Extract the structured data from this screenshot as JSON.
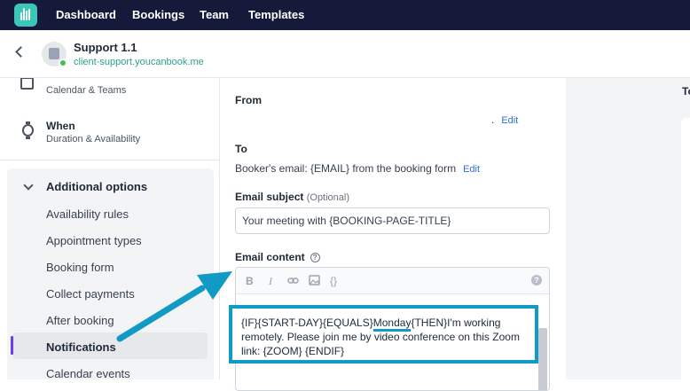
{
  "nav": {
    "items": [
      "Dashboard",
      "Bookings",
      "Team",
      "Templates"
    ]
  },
  "header": {
    "title": "Support 1.1",
    "url": "client-support.youcanbook.me"
  },
  "sidebar": {
    "calendar_sub": "Calendar & Teams",
    "when_title": "When",
    "when_sub": "Duration & Availability",
    "group_title": "Additional options",
    "items": [
      {
        "label": "Availability rules",
        "active": false
      },
      {
        "label": "Appointment types",
        "active": false
      },
      {
        "label": "Booking form",
        "active": false
      },
      {
        "label": "Collect payments",
        "active": false
      },
      {
        "label": "After booking",
        "active": false
      },
      {
        "label": "Notifications",
        "active": true
      },
      {
        "label": "Calendar events",
        "active": false
      }
    ]
  },
  "main": {
    "from_label": "From",
    "from_value": ".",
    "from_edit": "Edit",
    "to_label": "To",
    "to_value": "Booker's email: {EMAIL} from the booking form",
    "to_edit": "Edit",
    "subject_label": "Email subject",
    "subject_optional": "(Optional)",
    "subject_value": "Your meeting with {BOOKING-PAGE-TITLE}",
    "content_label": "Email content",
    "content_help": "?",
    "toolbar": {
      "bold": "B",
      "italic": "I",
      "code": "{}",
      "help": "?"
    },
    "highlight": {
      "part1": "{IF}{START-DAY}{EQUALS}",
      "part2": "Monday",
      "part3": "{THEN}I'm working remotely. Please join me by video conference on this Zoom link: {ZOOM} {ENDIF}"
    }
  },
  "right_panel": {
    "text": "To"
  },
  "colors": {
    "nav_bg": "#161a3a",
    "brand": "#3bc6b9",
    "link": "#2f6fd6",
    "accent": "#6d3df2",
    "annotation": "#119bc4",
    "online": "#3cc35f"
  }
}
